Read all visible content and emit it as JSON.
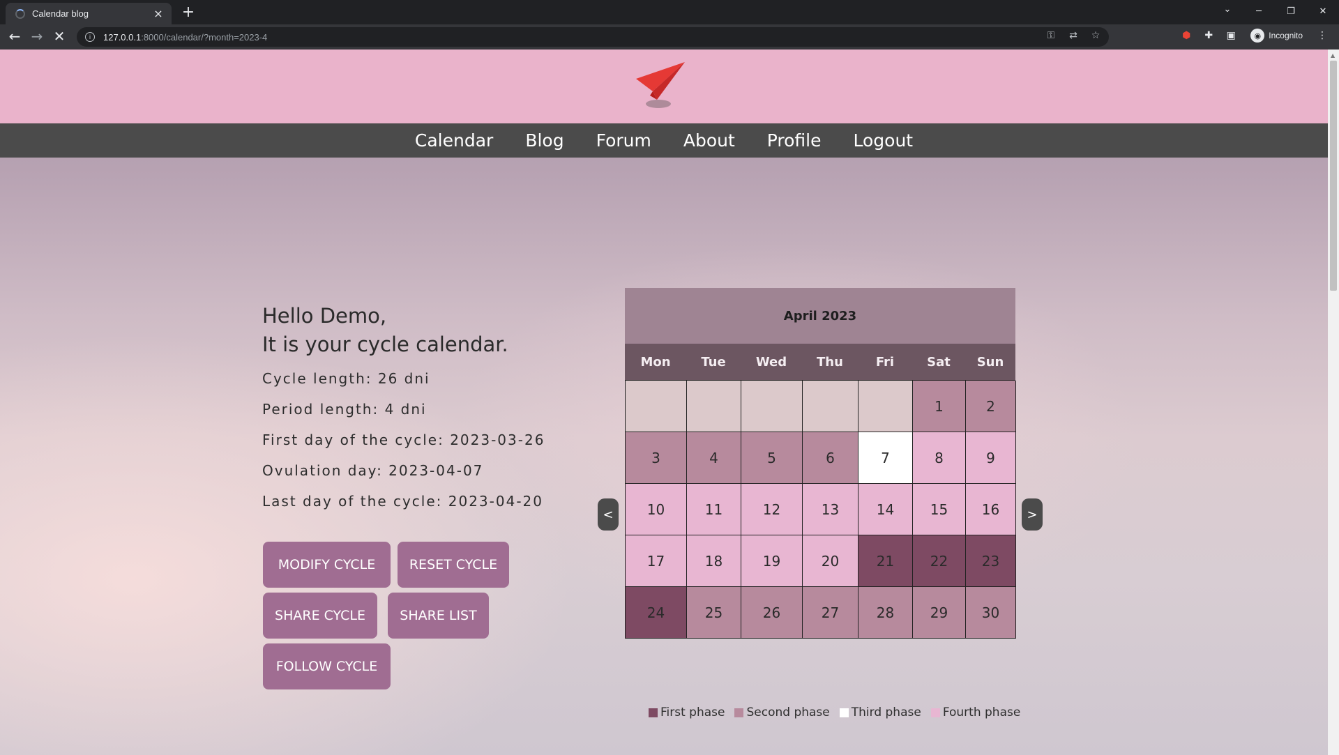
{
  "browser": {
    "tab_title": "Calendar blog",
    "tab_close": "×",
    "new_tab": "+",
    "url_host": "127.0.0.1",
    "url_rest": ":8000/calendar/?month=2023-4",
    "profile_label": "Incognito"
  },
  "nav": {
    "items": [
      "Calendar",
      "Blog",
      "Forum",
      "About",
      "Profile",
      "Logout"
    ]
  },
  "info": {
    "greeting_line1": "Hello Demo,",
    "greeting_line2": "It is your cycle calendar.",
    "cycle_length": "Cycle length: 26 dni",
    "period_length": "Period length: 4 dni",
    "first_day": "First day of the cycle: 2023-03-26",
    "ovulation_day": "Ovulation day: 2023-04-07",
    "last_day": "Last day of the cycle: 2023-04-20"
  },
  "buttons": {
    "modify": "MODIFY CYCLE",
    "reset": "RESET CYCLE",
    "share_cycle": "SHARE CYCLE",
    "share_list": "SHARE LIST",
    "follow": "FOLLOW CYCLE"
  },
  "calendar": {
    "title": "April 2023",
    "prev": "<",
    "next": ">",
    "weekdays": [
      "Mon",
      "Tue",
      "Wed",
      "Thu",
      "Fri",
      "Sat",
      "Sun"
    ],
    "phase_colors": {
      "empty": "#dcc9cb",
      "first": "#7e4a63",
      "second": "#b78a9d",
      "third": "#ffffff",
      "fourth": "#e8b6d2"
    },
    "days": [
      {
        "day": "",
        "phase": "empty"
      },
      {
        "day": "",
        "phase": "empty"
      },
      {
        "day": "",
        "phase": "empty"
      },
      {
        "day": "",
        "phase": "empty"
      },
      {
        "day": "",
        "phase": "empty"
      },
      {
        "day": "1",
        "phase": "second"
      },
      {
        "day": "2",
        "phase": "second"
      },
      {
        "day": "3",
        "phase": "second"
      },
      {
        "day": "4",
        "phase": "second"
      },
      {
        "day": "5",
        "phase": "second"
      },
      {
        "day": "6",
        "phase": "second"
      },
      {
        "day": "7",
        "phase": "third"
      },
      {
        "day": "8",
        "phase": "fourth"
      },
      {
        "day": "9",
        "phase": "fourth"
      },
      {
        "day": "10",
        "phase": "fourth"
      },
      {
        "day": "11",
        "phase": "fourth"
      },
      {
        "day": "12",
        "phase": "fourth"
      },
      {
        "day": "13",
        "phase": "fourth"
      },
      {
        "day": "14",
        "phase": "fourth"
      },
      {
        "day": "15",
        "phase": "fourth"
      },
      {
        "day": "16",
        "phase": "fourth"
      },
      {
        "day": "17",
        "phase": "fourth"
      },
      {
        "day": "18",
        "phase": "fourth"
      },
      {
        "day": "19",
        "phase": "fourth"
      },
      {
        "day": "20",
        "phase": "fourth"
      },
      {
        "day": "21",
        "phase": "first"
      },
      {
        "day": "22",
        "phase": "first"
      },
      {
        "day": "23",
        "phase": "first"
      },
      {
        "day": "24",
        "phase": "first"
      },
      {
        "day": "25",
        "phase": "second"
      },
      {
        "day": "26",
        "phase": "second"
      },
      {
        "day": "27",
        "phase": "second"
      },
      {
        "day": "28",
        "phase": "second"
      },
      {
        "day": "29",
        "phase": "second"
      },
      {
        "day": "30",
        "phase": "second"
      }
    ],
    "legend": [
      {
        "label": "First phase",
        "color": "#7e4a63"
      },
      {
        "label": "Second phase",
        "color": "#b78a9d"
      },
      {
        "label": "Third phase",
        "color": "#ffffff"
      },
      {
        "label": "Fourth phase",
        "color": "#e8b6d2"
      }
    ]
  }
}
